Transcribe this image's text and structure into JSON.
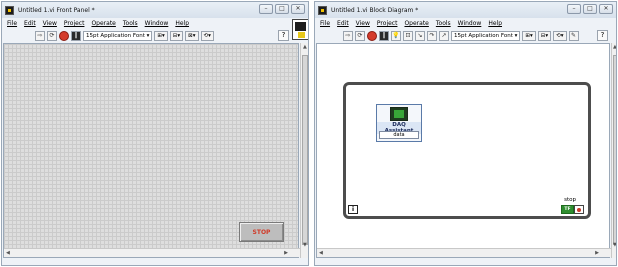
{
  "front_panel": {
    "title": "Untitled 1.vi Front Panel *",
    "menus": [
      "File",
      "Edit",
      "View",
      "Project",
      "Operate",
      "Tools",
      "Window",
      "Help"
    ],
    "font": "15pt Application Font",
    "stop_label": "STOP"
  },
  "block_diagram": {
    "title": "Untitled 1.vi Block Diagram *",
    "menus": [
      "File",
      "Edit",
      "View",
      "Project",
      "Operate",
      "Tools",
      "Window",
      "Help"
    ],
    "font": "15pt Application Font",
    "daq_title": "DAQ Assistant",
    "daq_output": "data",
    "iteration_terminal": "i",
    "stop_terminal_label": "stop",
    "stop_terminal_value": "TF"
  },
  "window_controls": {
    "minimize": "–",
    "maximize": "□",
    "close": "✕"
  },
  "colors": {
    "stop_text": "#d03a28",
    "grid": "#dedede",
    "loop_border": "#4d4d4d"
  }
}
